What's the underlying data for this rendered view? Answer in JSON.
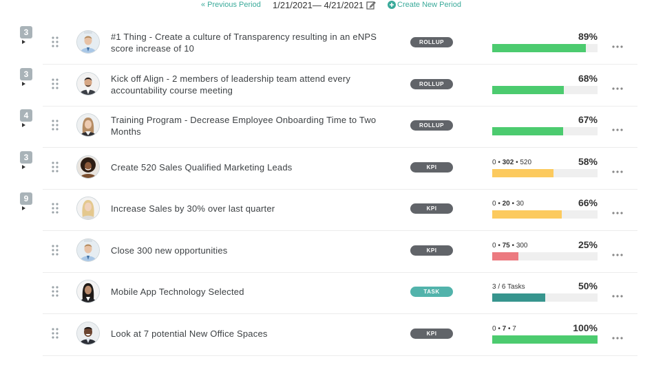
{
  "header": {
    "prev_label": "« Previous Period",
    "date_range": "1/21/2021— 4/21/2021",
    "create_label": "Create New Period",
    "accent": "#3aaa9a"
  },
  "colors": {
    "green": "#4ccb6f",
    "yellow": "#fcca5e",
    "red": "#ec7a80",
    "teal": "#37958e"
  },
  "rows": [
    {
      "count": "3",
      "title": "#1 Thing - Create a culture of Transparency resulting in an eNPS score increase of 10",
      "badge": "ROLLUP",
      "badge_type": "rollup",
      "kpi": null,
      "percent_label": "89%",
      "progress": 0.89,
      "bar_color": "green",
      "avatar": "man-shirt-icon"
    },
    {
      "count": "3",
      "title": "Kick off Align - 2 members of leadership team attend every accountability course meeting",
      "badge": "ROLLUP",
      "badge_type": "rollup",
      "kpi": null,
      "percent_label": "68%",
      "progress": 0.68,
      "bar_color": "green",
      "avatar": "man-suit-icon"
    },
    {
      "count": "4",
      "title": "Training Program - Decrease Employee Onboarding Time to Two Months",
      "badge": "ROLLUP",
      "badge_type": "rollup",
      "kpi": null,
      "percent_label": "67%",
      "progress": 0.67,
      "bar_color": "green",
      "avatar": "woman-icon"
    },
    {
      "count": "3",
      "title": "Create 520 Sales Qualified Marketing Leads",
      "badge": "KPI",
      "badge_type": "kpi",
      "kpi": {
        "start": "0",
        "current": "302",
        "target": "520"
      },
      "percent_label": "58%",
      "progress": 0.58,
      "bar_color": "yellow",
      "avatar": "woman-curly-icon"
    },
    {
      "count": "9",
      "title": "Increase Sales by 30% over last quarter",
      "badge": "KPI",
      "badge_type": "kpi",
      "kpi": {
        "start": "0",
        "current": "20",
        "target": "30"
      },
      "percent_label": "66%",
      "progress": 0.66,
      "bar_color": "yellow",
      "avatar": "woman-blonde-icon"
    },
    {
      "count": null,
      "title": "Close 300 new opportunities",
      "badge": "KPI",
      "badge_type": "kpi",
      "kpi": {
        "start": "0",
        "current": "75",
        "target": "300"
      },
      "percent_label": "25%",
      "progress": 0.25,
      "bar_color": "red",
      "avatar": "man-shirt-icon"
    },
    {
      "count": null,
      "title": "Mobile App Technology Selected",
      "badge": "TASK",
      "badge_type": "task",
      "kpi": null,
      "tasks": "3 / 6 Tasks",
      "percent_label": "50%",
      "progress": 0.5,
      "bar_color": "teal",
      "avatar": "woman-dark-icon"
    },
    {
      "count": null,
      "title": "Look at 7 potential New Office Spaces",
      "badge": "KPI",
      "badge_type": "kpi",
      "kpi": {
        "start": "0",
        "current": "7",
        "target": "7"
      },
      "percent_label": "100%",
      "progress": 1.0,
      "bar_color": "green",
      "avatar": "man-smiling-icon"
    }
  ]
}
